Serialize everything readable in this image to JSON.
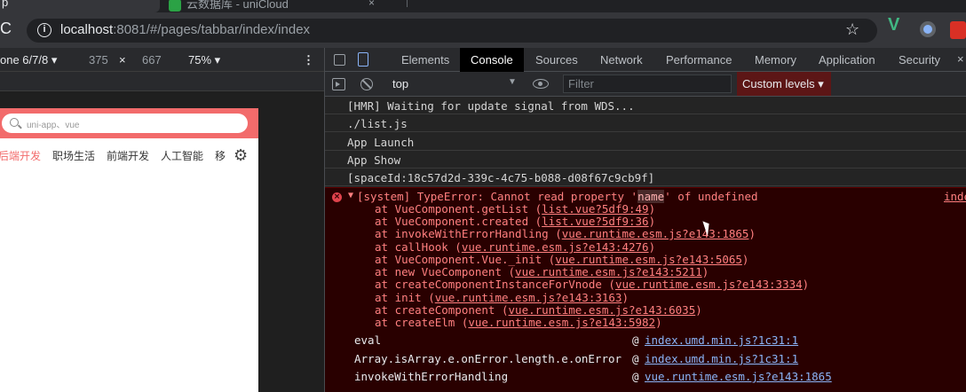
{
  "browser": {
    "tab1_label": "p",
    "tab2_label": "云数据库 - uniCloud",
    "tab2_close": "×",
    "url_host": "localhost",
    "url_rest": ":8081/#/pages/tabbar/index/index",
    "star_icon": "☆",
    "reload_icon": "C"
  },
  "device_toolbar": {
    "device": "one 6/7/8 ▾",
    "width": "375",
    "times": "×",
    "height": "667",
    "zoom": "75% ▾",
    "more": "⋮"
  },
  "app": {
    "search_placeholder": "uni-app、vue",
    "tabs": [
      "后端开发",
      "职场生活",
      "前端开发",
      "人工智能",
      "移"
    ],
    "active_tab": 0,
    "accent_color": "#f26b6b"
  },
  "devtools": {
    "tabs": [
      "Elements",
      "Console",
      "Sources",
      "Network",
      "Performance",
      "Memory",
      "Application",
      "Security"
    ],
    "active_tab": "Console",
    "close": "×",
    "context": "top",
    "filter_placeholder": "Filter",
    "levels": "Custom levels ▾"
  },
  "console": {
    "logs": [
      "[HMR] Waiting for update signal from WDS...",
      "./list.js",
      "App Launch",
      "App Show",
      "[spaceId:18c57d2d-339c-4c75-b088-d08f67c9cb9f]"
    ],
    "error": {
      "prefix": "[system] TypeError: Cannot read property '",
      "highlight": "name",
      "suffix": "' of undefined",
      "source": "inde"
    },
    "trace": [
      {
        "pre": "at VueComponent.getList (",
        "link": "list.vue?5df9:49",
        "post": ")"
      },
      {
        "pre": "at VueComponent.created (",
        "link": "list.vue?5df9:36",
        "post": ")"
      },
      {
        "pre": "at invokeWithErrorHandling (",
        "link": "vue.runtime.esm.js?e143:1865",
        "post": ")"
      },
      {
        "pre": "at callHook (",
        "link": "vue.runtime.esm.js?e143:4276",
        "post": ")"
      },
      {
        "pre": "at VueComponent.Vue._init (",
        "link": "vue.runtime.esm.js?e143:5065",
        "post": ")"
      },
      {
        "pre": "at new VueComponent (",
        "link": "vue.runtime.esm.js?e143:5211",
        "post": ")"
      },
      {
        "pre": "at createComponentInstanceForVnode (",
        "link": "vue.runtime.esm.js?e143:3334",
        "post": ")"
      },
      {
        "pre": "at init (",
        "link": "vue.runtime.esm.js?e143:3163",
        "post": ")"
      },
      {
        "pre": "at createComponent (",
        "link": "vue.runtime.esm.js?e143:6035",
        "post": ")"
      },
      {
        "pre": "at createElm (",
        "link": "vue.runtime.esm.js?e143:5982",
        "post": ")"
      }
    ],
    "stack_rows": [
      {
        "fn": "eval",
        "at": "@",
        "src": "index.umd.min.js?1c31:1"
      },
      {
        "fn": "Array.isArray.e.onError.length.e.onError",
        "at": "@",
        "src": "index.umd.min.js?1c31:1"
      },
      {
        "fn": "invokeWithErrorHandling",
        "at": "@",
        "src": "vue.runtime.esm.js?e143:1865"
      }
    ]
  }
}
